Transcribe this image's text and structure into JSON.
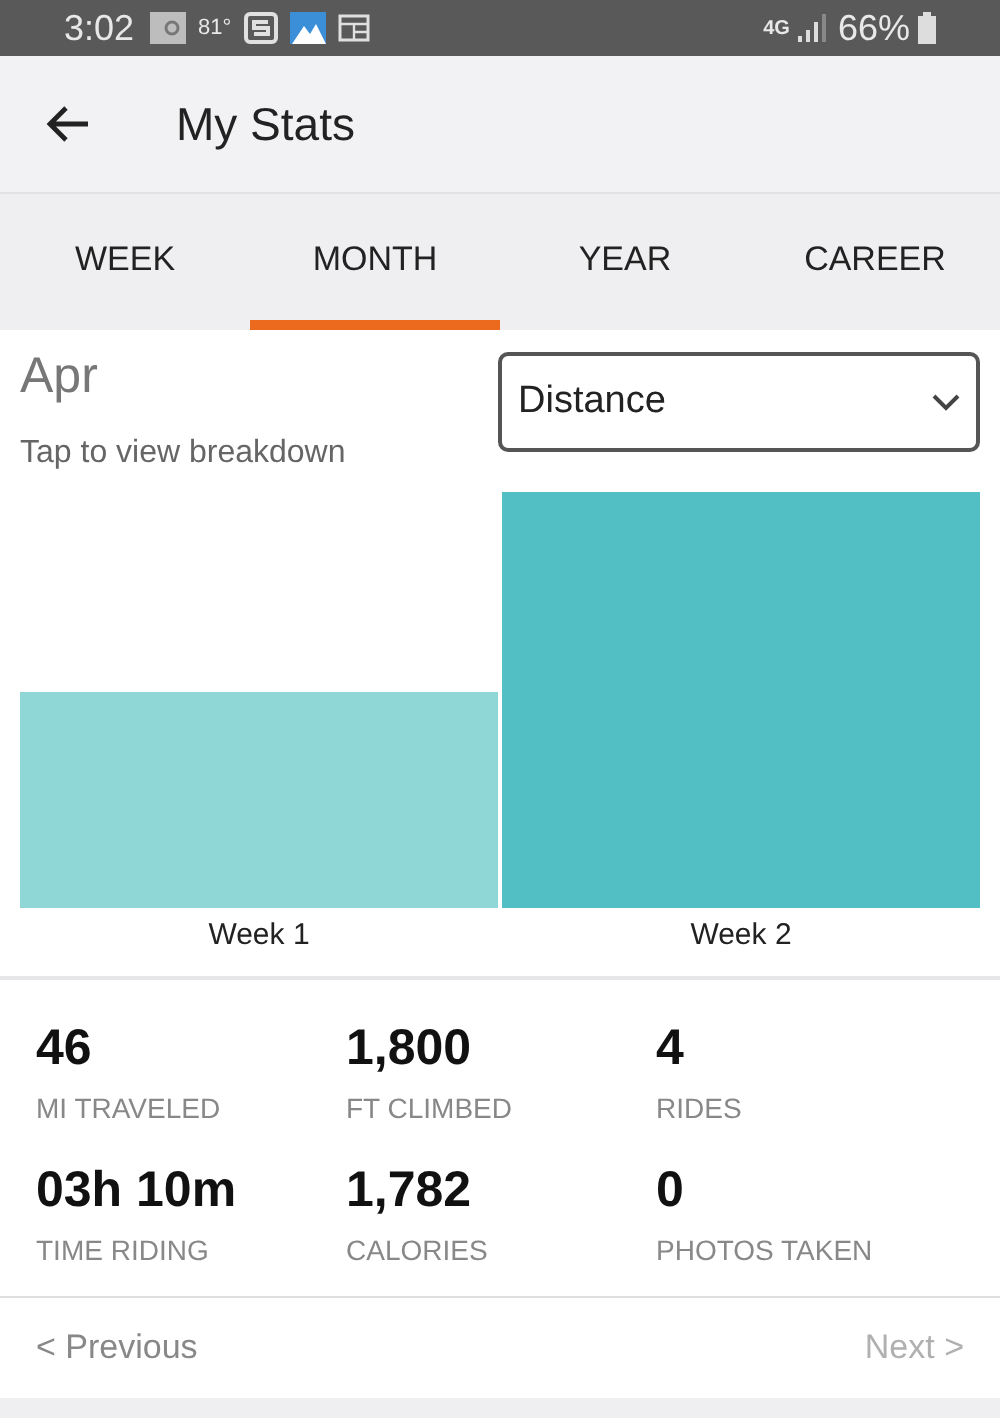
{
  "status_bar": {
    "time": "3:02",
    "temperature": "81°",
    "network": "4G",
    "battery": "66%"
  },
  "app_bar": {
    "title": "My Stats"
  },
  "tabs": [
    {
      "label": "WEEK",
      "selected": false
    },
    {
      "label": "MONTH",
      "selected": true
    },
    {
      "label": "YEAR",
      "selected": false
    },
    {
      "label": "CAREER",
      "selected": false
    }
  ],
  "period": {
    "title": "Apr",
    "hint": "Tap to view breakdown"
  },
  "metric_dropdown": {
    "value": "Distance"
  },
  "chart": {
    "bars": [
      {
        "label": "Week 1",
        "selected": false
      },
      {
        "label": "Week 2",
        "selected": true
      }
    ]
  },
  "stats": [
    {
      "value": "46",
      "label": "MI TRAVELED"
    },
    {
      "value": "1,800",
      "label": "FT CLIMBED"
    },
    {
      "value": "4",
      "label": "RIDES"
    },
    {
      "value": "03h 10m",
      "label": "TIME RIDING"
    },
    {
      "value": "1,782",
      "label": "CALORIES"
    },
    {
      "value": "0",
      "label": "PHOTOS TAKEN"
    }
  ],
  "pager": {
    "previous": {
      "label": "< Previous",
      "disabled": false
    },
    "next": {
      "label": "Next >",
      "disabled": true
    }
  }
}
